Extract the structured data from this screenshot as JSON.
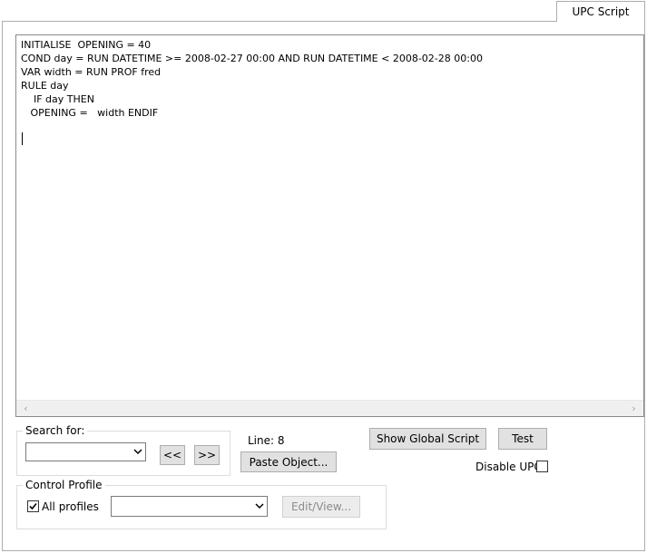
{
  "tab": {
    "label": "UPC Script"
  },
  "editor": {
    "code": "INITIALISE  OPENING = 40\nCOND day = RUN DATETIME >= 2008-02-27 00:00 AND RUN DATETIME < 2008-02-28 00:00\nVAR width = RUN PROF fred\nRULE day\n    IF day THEN\n   OPENING =   width ENDIF"
  },
  "search": {
    "legend": "Search for:",
    "value": "",
    "prev_label": "<<",
    "next_label": ">>"
  },
  "line_info": {
    "label": "Line: 8"
  },
  "buttons": {
    "paste_object": "Paste Object...",
    "show_global_script": "Show Global Script",
    "test": "Test",
    "edit_view": "Edit/View..."
  },
  "disable_upc": {
    "label": "Disable UPC",
    "checked": false
  },
  "control_profile": {
    "legend": "Control Profile",
    "all_profiles_label": "All profiles",
    "all_profiles_checked": true,
    "profile_value": ""
  }
}
